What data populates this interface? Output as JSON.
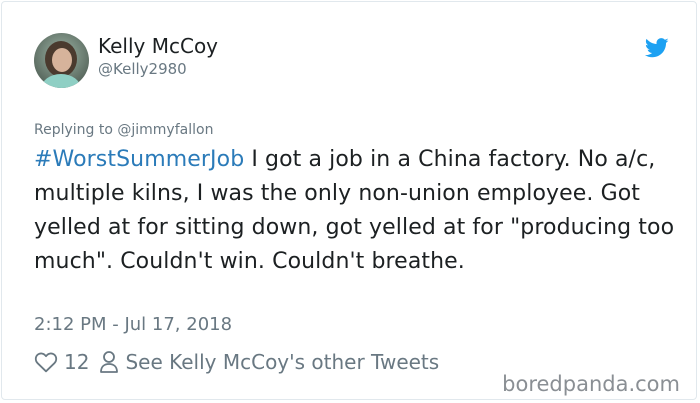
{
  "tweet": {
    "author_name": "Kelly McCoy",
    "author_handle": "@Kelly2980",
    "replying_to": "Replying to @jimmyfallon",
    "hashtag": "#WorstSummerJob",
    "body": " I got a job in a China factory. No a/c, multiple kilns, I was the only non-union employee. Got yelled at for sitting down, got yelled at for \"producing too much\". Couldn't win. Couldn't breathe.",
    "timestamp": "2:12 PM - Jul 17, 2018",
    "like_count": "12",
    "profile_link": "See Kelly McCoy's other Tweets"
  },
  "icons": {
    "brand": "twitter-bird-icon",
    "like": "heart-icon",
    "profile": "person-icon"
  },
  "colors": {
    "link": "#2b7bb9",
    "bird": "#1da1f2",
    "secondary_text": "#697882",
    "border": "#e1e8ed"
  },
  "watermark": "boredpanda.com"
}
